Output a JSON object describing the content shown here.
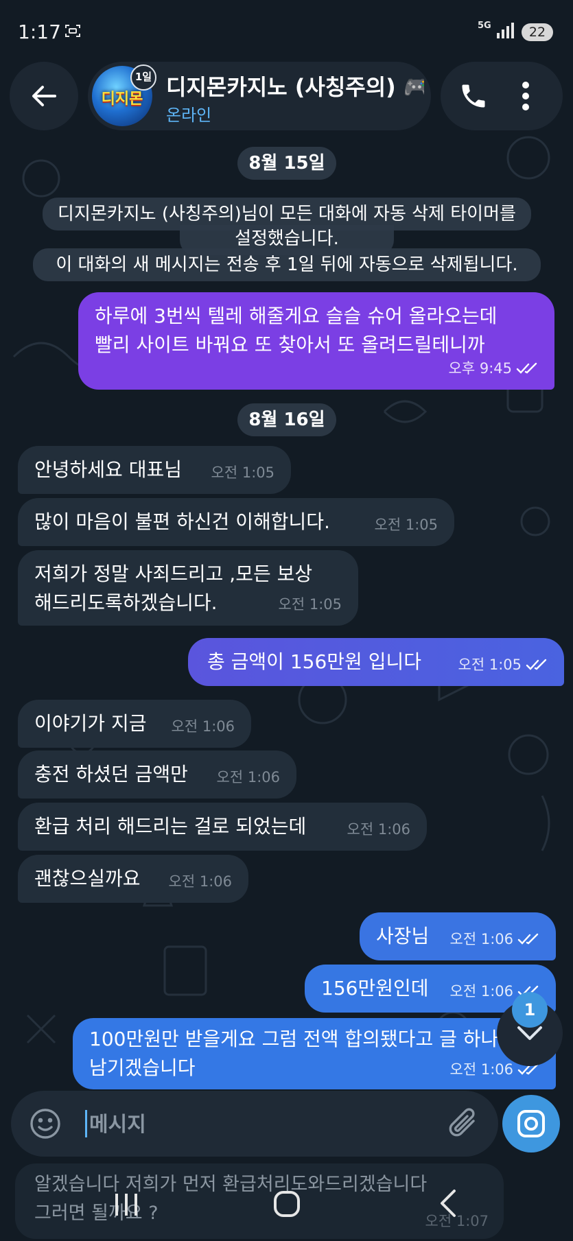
{
  "status_bar": {
    "time": "1:17",
    "network": "5G",
    "battery": "22"
  },
  "header": {
    "chat_title": "디지몬카지노 (사칭주의) 🎮",
    "chat_status": "온라인",
    "avatar_text": "디지몬",
    "timer_badge": "1일"
  },
  "colors": {
    "background": "#121b24",
    "incoming_bubble": "#222e3a",
    "accent": "#5eb5f7",
    "outgoing_purple": "#7b3fe4",
    "outgoing_blue": "#3478e5"
  },
  "dates": {
    "first": "8월 15일",
    "second": "8월 16일"
  },
  "service_message": {
    "line1": "디지몬카지노 (사칭주의)님이 모든 대화에 자동 삭제 타이머를",
    "line2": "설정했습니다.",
    "line3": "이 대화의 새 메시지는 전송 후 1일 뒤에 자동으로 삭제됩니다."
  },
  "messages": [
    {
      "direction": "out",
      "text": "하루에 3번씩 텔레 해줄게요 슬슬 슈어 올라오는데\n빨리 사이트 바꿔요 또 찾아서 또 올려드릴테니까",
      "time": "오후 9:45",
      "read": true
    },
    {
      "direction": "in",
      "text": "안녕하세요 대표님",
      "time": "오전 1:05"
    },
    {
      "direction": "in",
      "text": "많이 마음이 불편 하신건 이해합니다.",
      "time": "오전 1:05"
    },
    {
      "direction": "in",
      "text": "저희가 정말 사죄드리고 ,모든 보상\n해드리도록하겠습니다.",
      "time": "오전 1:05"
    },
    {
      "direction": "out",
      "text": "총 금액이 156만원 입니다",
      "time": "오전 1:05",
      "read": true
    },
    {
      "direction": "in",
      "text": "이야기가 지금",
      "time": "오전 1:06"
    },
    {
      "direction": "in",
      "text": "충전 하셨던 금액만",
      "time": "오전 1:06"
    },
    {
      "direction": "in",
      "text": "환급 처리 해드리는 걸로 되었는데",
      "time": "오전 1:06"
    },
    {
      "direction": "in",
      "text": "괜찮으실까요",
      "time": "오전 1:06"
    },
    {
      "direction": "out",
      "text": "사장님",
      "time": "오전 1:06",
      "read": true
    },
    {
      "direction": "out",
      "text": "156만원인데",
      "time": "오전 1:06",
      "read": true
    },
    {
      "direction": "out",
      "text": "100만원만 받을게요 그럼 전액 합의됐다고 글 하나\n남기겠습니다",
      "time": "오전 1:06",
      "read": true
    }
  ],
  "scroll_button": {
    "unread_count": "1",
    "icon": "chevron-down-icon"
  },
  "composer": {
    "placeholder": "메시지"
  },
  "draft_message": {
    "text": "알겠습니다 저희가 먼저 환급처리도와드리겠습니다\n그러면 될까요 ?",
    "time": "오전 1:07"
  },
  "icons": [
    "back-arrow-icon",
    "phone-icon",
    "more-vert-icon",
    "emoji-icon",
    "paperclip-icon",
    "camera-icon",
    "double-check-icon"
  ]
}
